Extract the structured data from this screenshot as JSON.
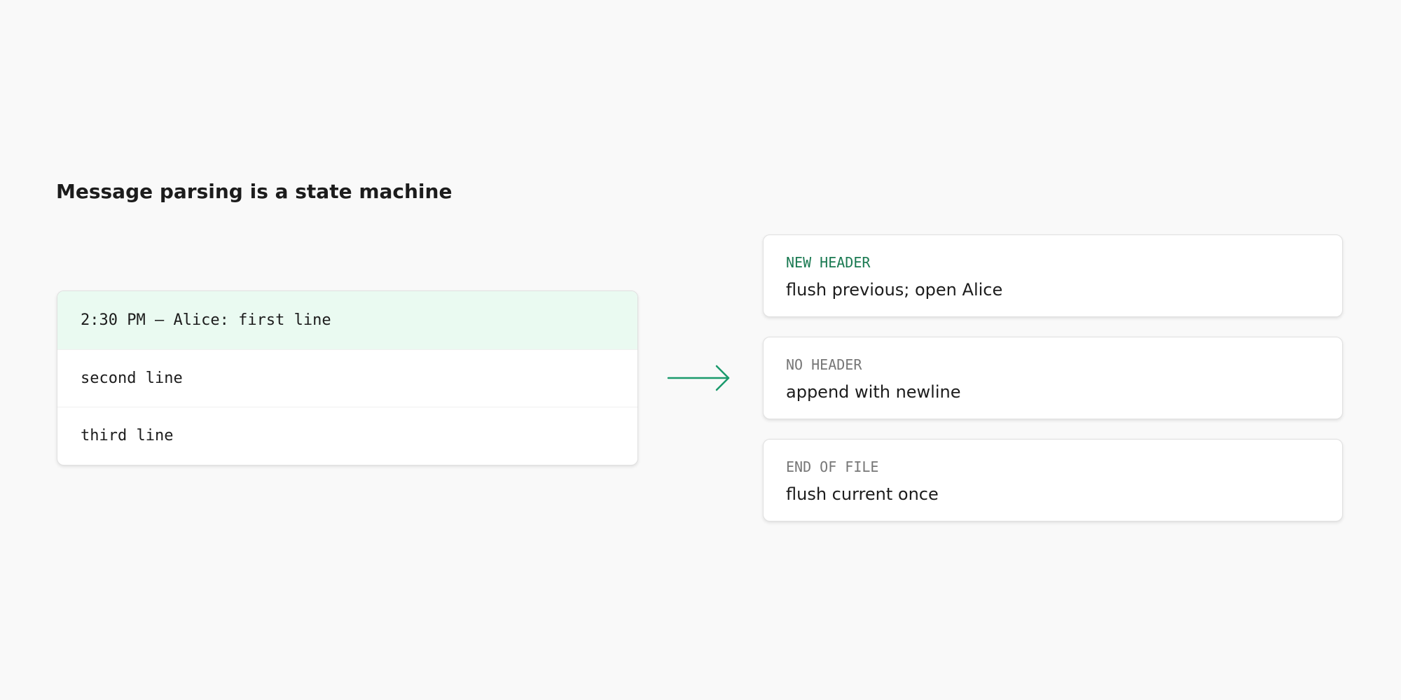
{
  "title": "Message parsing is a state machine",
  "lines": [
    "2:30 PM — Alice: first line",
    "second line",
    "third line"
  ],
  "events": [
    {
      "label": "NEW HEADER",
      "description": "flush previous; open Alice"
    },
    {
      "label": "NO HEADER",
      "description": "append with newline"
    },
    {
      "label": "END OF FILE",
      "description": "flush current once"
    }
  ],
  "colors": {
    "accent": "#1a9a6c",
    "accent_text": "#1a7a52",
    "highlight_row": "#eafaf1",
    "muted_label": "#777777",
    "background": "#f9f9f9"
  },
  "icons": {
    "arrow": "arrow-right-icon"
  }
}
